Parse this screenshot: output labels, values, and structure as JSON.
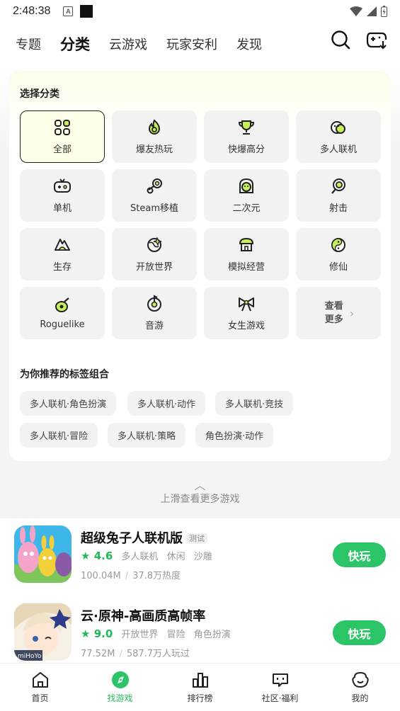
{
  "status_bar": {
    "time": "2:48:38",
    "notif_letter": "A"
  },
  "top_tabs": [
    {
      "label": "专题"
    },
    {
      "label": "分类"
    },
    {
      "label": "云游戏"
    },
    {
      "label": "玩家安利"
    },
    {
      "label": "发现"
    }
  ],
  "active_tab": "分类",
  "category_panel": {
    "title": "选择分类",
    "categories": [
      {
        "label": "全部",
        "icon": "grid-icon",
        "selected": true
      },
      {
        "label": "爆友热玩",
        "icon": "flame-icon"
      },
      {
        "label": "快爆高分",
        "icon": "trophy-icon"
      },
      {
        "label": "多人联机",
        "icon": "multiplayer-icon"
      },
      {
        "label": "单机",
        "icon": "gamepad-icon"
      },
      {
        "label": "Steam移植",
        "icon": "steam-icon"
      },
      {
        "label": "二次元",
        "icon": "anime-icon"
      },
      {
        "label": "射击",
        "icon": "target-icon"
      },
      {
        "label": "生存",
        "icon": "survival-icon"
      },
      {
        "label": "开放世界",
        "icon": "world-icon"
      },
      {
        "label": "模拟经营",
        "icon": "shop-icon"
      },
      {
        "label": "修仙",
        "icon": "yin-yang-icon"
      },
      {
        "label": "Roguelike",
        "icon": "rogue-icon"
      },
      {
        "label": "音游",
        "icon": "music-disc-icon"
      },
      {
        "label": "女生游戏",
        "icon": "bow-icon"
      }
    ],
    "more_label": "查看更多",
    "recommend_title": "为你推荐的标签组合",
    "recommend_tags": [
      "多人联机·角色扮演",
      "多人联机·动作",
      "多人联机·竞技",
      "多人联机·冒险",
      "多人联机·策略",
      "角色扮演·动作"
    ]
  },
  "pull_hint": "上滑查看更多游戏",
  "games": [
    {
      "name": "超级兔子人联机版",
      "badge": "测试",
      "rating": "4.6",
      "tags": [
        "多人联机",
        "休闲",
        "沙雕"
      ],
      "size": "100.04M",
      "stat": "37.8万热度",
      "button": "快玩"
    },
    {
      "name": "云·原神-高画质高帧率",
      "badge": "",
      "rating": "9.0",
      "tags": [
        "开放世界",
        "冒险",
        "角色扮演"
      ],
      "size": "77.52M",
      "stat": "587.7万人玩过",
      "button": "快玩"
    }
  ],
  "bottom_nav": [
    {
      "label": "首页",
      "icon": "home-icon"
    },
    {
      "label": "找游戏",
      "icon": "find-game-icon"
    },
    {
      "label": "排行榜",
      "icon": "ranking-icon"
    },
    {
      "label": "社区·福利",
      "icon": "community-icon"
    },
    {
      "label": "我的",
      "icon": "profile-icon"
    }
  ],
  "colors": {
    "accent_green": "#2bc467",
    "highlight_lime": "#b9f25a",
    "text_dark": "#222222"
  }
}
